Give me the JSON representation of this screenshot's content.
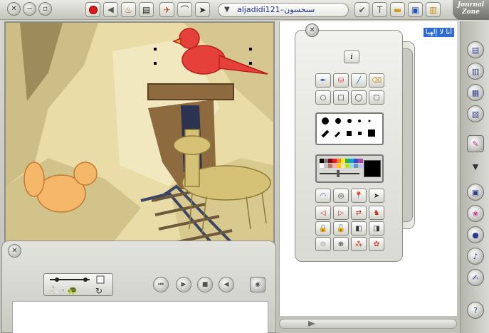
{
  "window": {
    "brand": "Journal Zone",
    "document_title": "aljadidi121–سنحسون"
  },
  "journal": {
    "arabic_text": "أنا لا إلهيا"
  },
  "palette": {
    "info_label": "i",
    "colors": [
      "#000000",
      "#7f7f7f",
      "#880015",
      "#ed1c24",
      "#ff7f27",
      "#fff200",
      "#22b14c",
      "#00a2e8",
      "#3f48cc",
      "#a349a4",
      "#ffffff",
      "#c3c3c3",
      "#b97a57",
      "#ffaec9",
      "#ffc90e",
      "#efe4b0",
      "#b5e61d",
      "#99d9ea",
      "#7092be",
      "#c8bfe7"
    ],
    "current_color": "#000000"
  },
  "colors": {
    "chrome": "#c9cbc2",
    "canvas_bg": "#e7d9a3",
    "selection": "#2c6ad6",
    "title_text": "#1b2e8f"
  }
}
